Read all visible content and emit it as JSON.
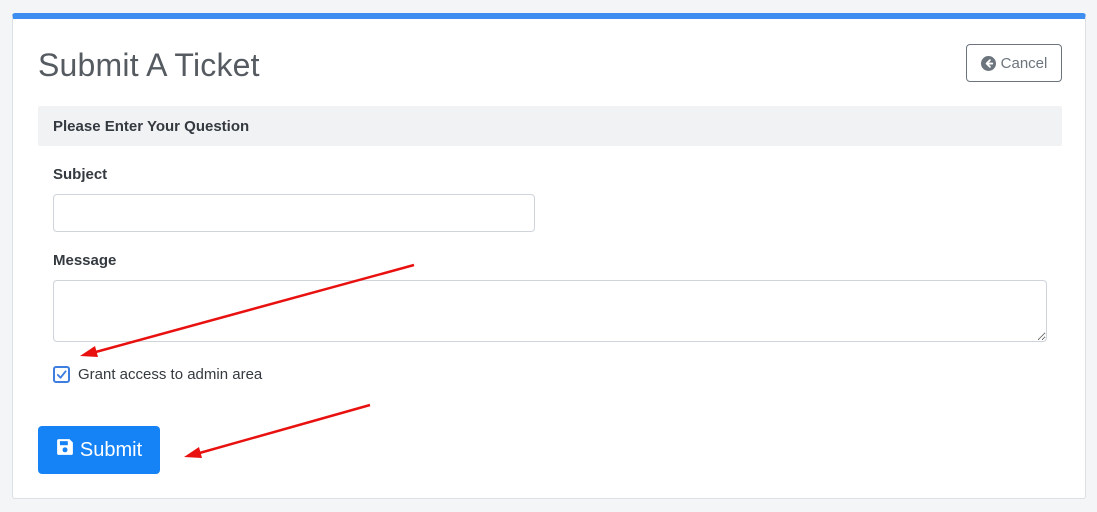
{
  "page": {
    "title": "Submit A Ticket",
    "cancel_label": "Cancel"
  },
  "form": {
    "section_header": "Please Enter Your Question",
    "subject_label": "Subject",
    "subject_value": "",
    "message_label": "Message",
    "message_value": "",
    "grant_access_label": "Grant access to admin area",
    "grant_access_checked": true,
    "submit_label": "Submit"
  },
  "icons": {
    "cancel": "arrow-circle-left-icon",
    "submit": "floppy-disk-save-icon",
    "checkbox": "checkmark-icon"
  },
  "colors": {
    "accent_top_border": "#3d8ef0",
    "primary_button": "#1583f5",
    "annotation_arrow": "#e8110f"
  }
}
